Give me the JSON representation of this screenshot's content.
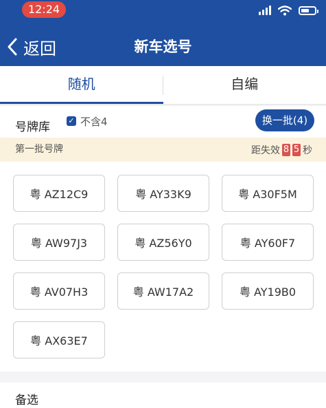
{
  "status_bar": {
    "time": "12:24",
    "icons": [
      "signal-icon",
      "wifi-icon",
      "battery-icon"
    ]
  },
  "nav": {
    "back_label": "返回",
    "back_icon": "chevron-left-icon",
    "title": "新车选号"
  },
  "tabs": [
    {
      "label": "随机",
      "active": true
    },
    {
      "label": "自编",
      "active": false
    }
  ],
  "toolbar": {
    "pool_label": "号牌库",
    "filter_label": "不含4",
    "filter_checked": true,
    "refresh_label": "换一批(4)"
  },
  "batch": {
    "title": "第一批号牌",
    "countdown_prefix": "距失效",
    "countdown_digits": [
      "8",
      "5"
    ],
    "countdown_unit": "秒"
  },
  "plates": [
    "粤 AZ12C9",
    "粤 AY33K9",
    "粤 A30F5M",
    "粤 AW97J3",
    "粤 AZ56Y0",
    "粤 AY60F7",
    "粤 AV07H3",
    "粤 AW17A2",
    "粤 AY19B0",
    "粤 AX63E7"
  ],
  "alternate": {
    "label": "备选"
  },
  "colors": {
    "brand_blue": "#1f4fa0",
    "time_pill_red": "#e34a42",
    "countdown_red": "#d9534f",
    "batch_bar_bg": "#fbf2dd"
  }
}
